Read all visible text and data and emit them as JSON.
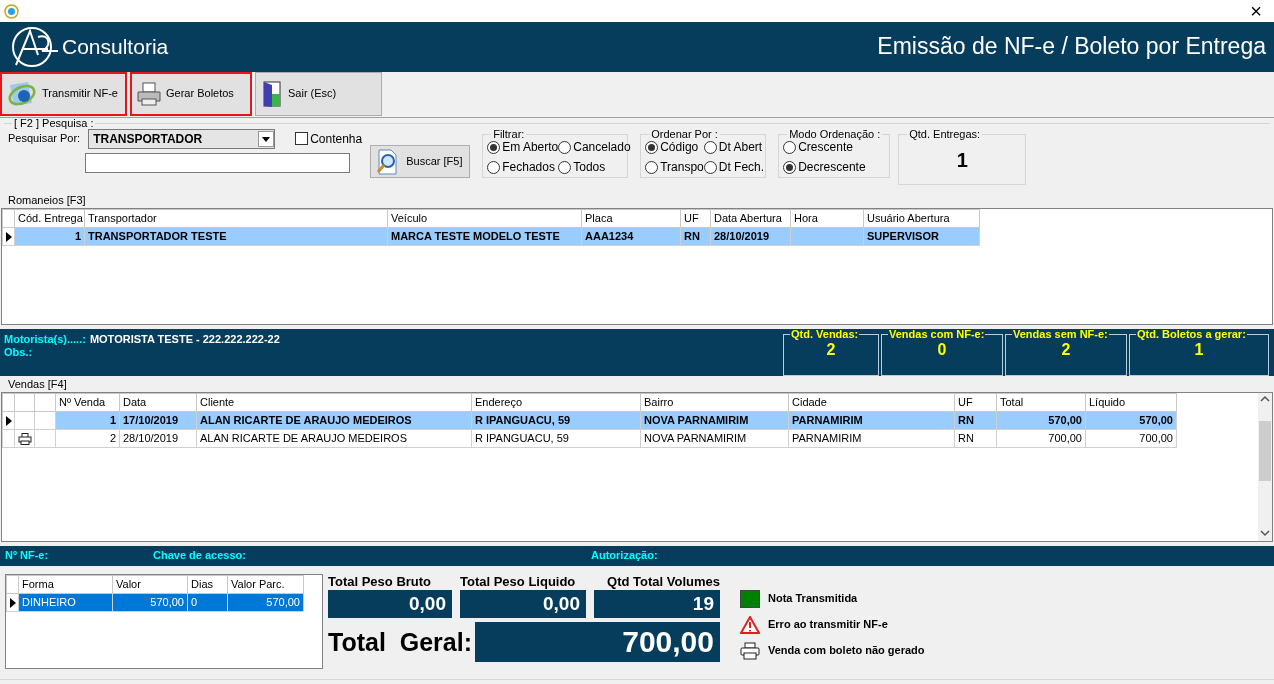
{
  "window": {
    "close": "×"
  },
  "header": {
    "brand": "Consultoria",
    "title": "Emissão de NF-e / Boleto por Entrega"
  },
  "toolbar": [
    {
      "kind": "nfe",
      "label": "Transmitir NF-e",
      "highlighted": true
    },
    {
      "kind": "printer",
      "label": "Gerar Boletos",
      "highlighted": true
    },
    {
      "kind": "door",
      "label": "Sair (Esc)",
      "highlighted": false
    }
  ],
  "search": {
    "group": "[ F2 ] Pesquisa :",
    "search_by_label": "Pesquisar Por:",
    "search_by_value": "TRANSPORTADOR",
    "contains": {
      "label": "Contenha",
      "checked": false
    },
    "button": "Buscar [F5]"
  },
  "filter": {
    "title": "Filtrar:",
    "options": [
      {
        "label": "Em Aberto",
        "selected": true
      },
      {
        "label": "Cancelado",
        "selected": false
      },
      {
        "label": "Fechados",
        "selected": false
      },
      {
        "label": "Todos",
        "selected": false
      }
    ]
  },
  "sort_by": {
    "title": "Ordenar Por :",
    "options": [
      {
        "label": "Código",
        "selected": true
      },
      {
        "label": "Dt Abert",
        "selected": false
      },
      {
        "label": "Transpo",
        "selected": false
      },
      {
        "label": "Dt Fech.",
        "selected": false
      }
    ]
  },
  "sort_mode": {
    "title": "Modo Ordenação :",
    "options": [
      {
        "label": "Crescente",
        "selected": false
      },
      {
        "label": "Decrescente",
        "selected": true
      }
    ]
  },
  "deliveries_count": {
    "label": "Qtd. Entregas:",
    "value": "1"
  },
  "romaneios": {
    "title": "Romaneios [F3]",
    "columns": [
      "Cód. Entrega",
      "Transportador",
      "Veículo",
      "Placa",
      "UF",
      "Data Abertura",
      "Hora",
      "Usuário Abertura"
    ],
    "rows": [
      {
        "selected": true,
        "current": true,
        "cells": [
          "1",
          "TRANSPORTADOR TESTE",
          "MARCA TESTE MODELO TESTE",
          "AAA1234",
          "RN",
          "28/10/2019",
          "",
          "SUPERVISOR"
        ]
      }
    ]
  },
  "driver": {
    "label": "Motorista(s).....:",
    "value": "MOTORISTA TESTE - 222.222.222-22",
    "obs_label": "Obs.:"
  },
  "stats": [
    {
      "label": "Qtd. Vendas:",
      "value": "2"
    },
    {
      "label": "Vendas com NF-e:",
      "value": "0"
    },
    {
      "label": "Vendas sem NF-e:",
      "value": "2"
    },
    {
      "label": "Qtd. Boletos a gerar:",
      "value": "1"
    }
  ],
  "vendas": {
    "title": "Vendas [F4]",
    "columns": [
      "Nº Venda",
      "Data",
      "Cliente",
      "Endereço",
      "Bairro",
      "Cidade",
      "UF",
      "Total",
      "Líquido"
    ],
    "rows": [
      {
        "selected": true,
        "current": true,
        "boleto_pending": false,
        "cells": [
          "1",
          "17/10/2019",
          "ALAN RICARTE DE ARAUJO MEDEIROS",
          "R IPANGUACU, 59",
          "NOVA PARNAMIRIM",
          "PARNAMIRIM",
          "RN",
          "570,00",
          "570,00"
        ]
      },
      {
        "selected": false,
        "current": false,
        "boleto_pending": true,
        "cells": [
          "2",
          "28/10/2019",
          "ALAN RICARTE DE ARAUJO MEDEIROS",
          "R IPANGUACU, 59",
          "NOVA PARNAMIRIM",
          "PARNAMIRIM",
          "RN",
          "700,00",
          "700,00"
        ]
      }
    ]
  },
  "nfe_info": {
    "number_label": "Nº NF-e:",
    "key_label": "Chave de acesso:",
    "auth_label": "Autorização:"
  },
  "payments": {
    "columns": [
      "Forma",
      "Valor",
      "Dias",
      "Valor Parc."
    ],
    "rows": [
      {
        "selected": true,
        "current": true,
        "cells": [
          "DINHEIRO",
          "570,00",
          "0",
          "570,00"
        ]
      }
    ]
  },
  "totals": [
    {
      "label": "Total Peso Bruto",
      "value": "0,00"
    },
    {
      "label": "Total Peso Liquido",
      "value": "0,00"
    },
    {
      "label": "Qtd Total Volumes",
      "value": "19"
    }
  ],
  "grand_total": {
    "label": "Total  Geral:",
    "value": "700,00"
  },
  "legend": [
    {
      "kind": "swatch",
      "color": "#008000",
      "label": "Nota Transmitida"
    },
    {
      "kind": "warning",
      "label": "Erro ao transmitir NF-e"
    },
    {
      "kind": "printer",
      "label": "Venda com boleto não gerado"
    }
  ]
}
